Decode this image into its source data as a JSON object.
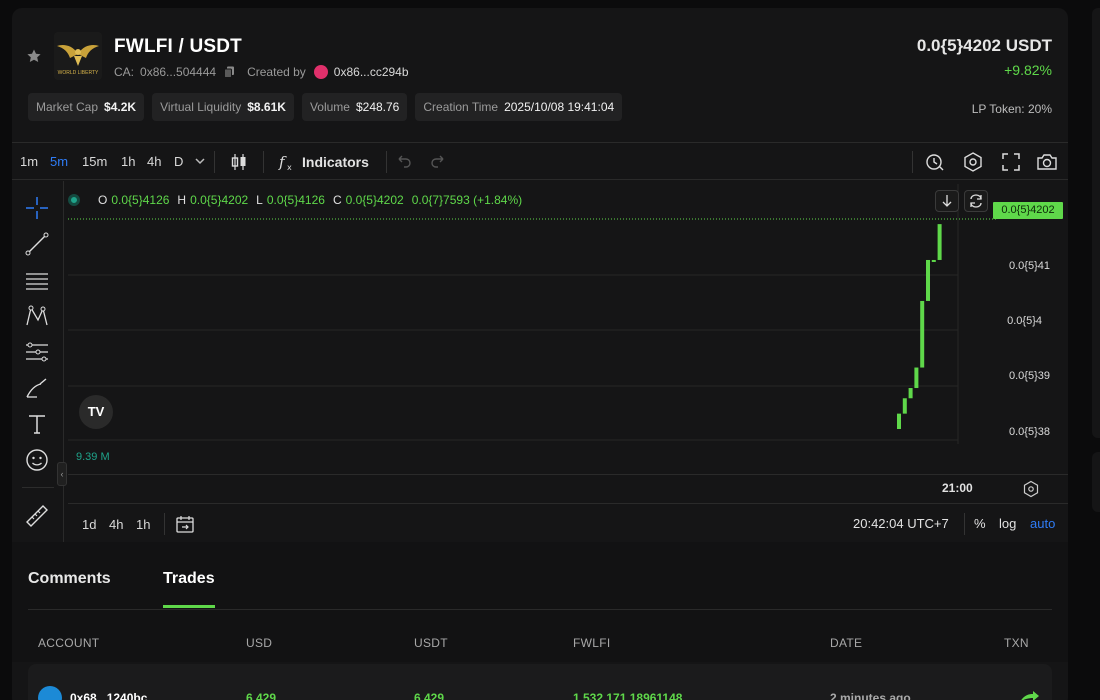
{
  "header": {
    "pair": "FWLFI / USDT",
    "ca_label": "CA:",
    "ca_value": "0x86...504444",
    "created_by_label": "Created by",
    "creator": "0x86...cc294b",
    "price": "0.0{5}4202 USDT",
    "change": "+9.82%",
    "logo_text": "WORLD LIBERTY",
    "lp_token": "LP Token: 20%"
  },
  "stats": [
    {
      "label": "Market Cap",
      "value": "$4.2K"
    },
    {
      "label": "Virtual Liquidity",
      "value": "$8.61K"
    },
    {
      "label": "Volume",
      "value": "$248.76"
    },
    {
      "label": "Creation Time",
      "value": "2025/10/08 19:41:04"
    }
  ],
  "chart_toolbar": {
    "timeframes": [
      "1m",
      "5m",
      "15m",
      "1h",
      "4h",
      "D"
    ],
    "active_timeframe": "5m",
    "indicators_label": "Indicators"
  },
  "ohlc": {
    "o_label": "O",
    "o": "0.0{5}4126",
    "h_label": "H",
    "h": "0.0{5}4202",
    "l_label": "L",
    "l": "0.0{5}4126",
    "c_label": "C",
    "c": "0.0{5}4202",
    "diff": "0.0{7}7593 (+1.84%)"
  },
  "price_axis": {
    "current": "0.0{5}4202",
    "ticks": [
      "0.0{5}41",
      "0.0{5}4",
      "0.0{5}39",
      "0.0{5}38"
    ]
  },
  "chart": {
    "volume_label": "9.39 M",
    "time_label": "21:00",
    "tv_logo": "TV",
    "candles": [
      {
        "open": 3.8e-06,
        "close": 3.83e-06
      },
      {
        "open": 3.83e-06,
        "close": 3.86e-06
      },
      {
        "open": 3.86e-06,
        "close": 3.88e-06
      },
      {
        "open": 3.88e-06,
        "close": 3.92e-06
      },
      {
        "open": 3.92e-06,
        "close": 4.05e-06
      },
      {
        "open": 4.05e-06,
        "close": 4.13e-06
      },
      {
        "open": 4.13e-06,
        "close": 4.13e-06
      },
      {
        "open": 4.13e-06,
        "close": 4.2e-06
      }
    ],
    "y_range": [
      3.8e-06,
      4.21e-06
    ]
  },
  "range_bar": {
    "ranges": [
      "1d",
      "4h",
      "1h"
    ],
    "clock": "20:42:04 UTC+7",
    "percent": "%",
    "log": "log",
    "auto": "auto"
  },
  "tabs": {
    "comments": "Comments",
    "trades": "Trades"
  },
  "table": {
    "headers": [
      "ACCOUNT",
      "USD",
      "USDT",
      "FWLFI",
      "DATE",
      "TXN"
    ],
    "rows": [
      {
        "account": "0x68...1240bc",
        "usd": "6.429",
        "usdt": "6.429",
        "fwlfi": "1,532,171.18961148",
        "date": "2 minutes ago"
      }
    ]
  },
  "colors": {
    "accent_green": "#5fd84a",
    "accent_blue": "#2f7cf6",
    "panel": "#151516"
  }
}
